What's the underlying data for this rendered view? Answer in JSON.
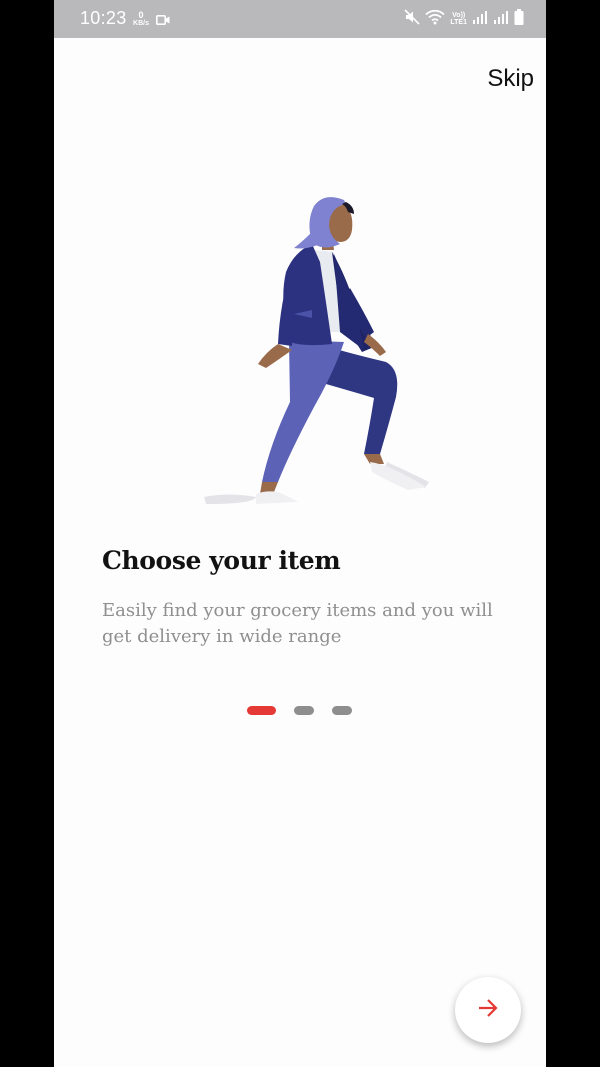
{
  "status_bar": {
    "time": "10:23",
    "speed_value": "0",
    "speed_unit": "KB/s",
    "volte_line1": "Vo))",
    "volte_line2": "LTE1",
    "icons": [
      "video-camera-icon",
      "mute-icon",
      "wifi-icon",
      "signal-icon",
      "signal-icon",
      "battery-icon"
    ]
  },
  "onboarding": {
    "skip_label": "Skip",
    "title": "Choose your item",
    "description": "Easily find your grocery items and you will get delivery in wide range",
    "pages": 3,
    "current_page": 1,
    "next_icon": "arrow-right-icon"
  },
  "colors": {
    "accent": "#e53935",
    "dot_inactive": "#8e8e8e",
    "background": "#fefdfe",
    "status_bar": "#b9b8bb"
  }
}
